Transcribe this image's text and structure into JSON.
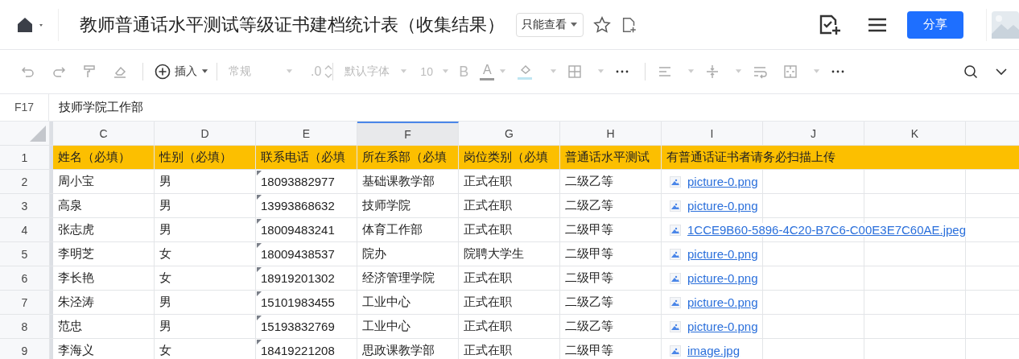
{
  "top_bar": {
    "title": "教师普通话水平测试等级证书建档统计表（收集结果）",
    "view_mode": "只能查看",
    "share_button": "分享"
  },
  "toolbar": {
    "insert": "插入",
    "number_format": "常规",
    "decimal": ".0",
    "font": "默认字体",
    "font_size": "10",
    "bold": "B",
    "font_color": "A"
  },
  "formula_bar": {
    "cell_ref": "F17",
    "value": "技师学院工作部"
  },
  "sheet": {
    "columns": [
      {
        "label": "C",
        "selected": false
      },
      {
        "label": "D",
        "selected": false
      },
      {
        "label": "E",
        "selected": false
      },
      {
        "label": "F",
        "selected": true
      },
      {
        "label": "G",
        "selected": false
      },
      {
        "label": "H",
        "selected": false
      },
      {
        "label": "I",
        "selected": false
      },
      {
        "label": "J",
        "selected": false
      },
      {
        "label": "K",
        "selected": false
      }
    ],
    "header_row": {
      "number": "1",
      "cells": [
        "姓名（必填）",
        "性别（必填）",
        "联系电话（必填",
        "所在系部（必填",
        "岗位类别（必填",
        "普通话水平测试"
      ],
      "wide_cell": "有普通话证书者请务必扫描上传"
    },
    "rows": [
      {
        "number": "2",
        "cells": [
          "周小宝",
          "男",
          "18093882977",
          "基础课教学部",
          "正式在职",
          "二级乙等"
        ],
        "attachment": "picture-0.png"
      },
      {
        "number": "3",
        "cells": [
          "高泉",
          "男",
          "13993868632",
          "技师学院",
          "正式在职",
          "二级乙等"
        ],
        "attachment": "picture-0.png"
      },
      {
        "number": "4",
        "cells": [
          "张志虎",
          "男",
          "18009483241",
          "体育工作部",
          "正式在职",
          "二级甲等"
        ],
        "attachment": "1CCE9B60-5896-4C20-B7C6-C00E3E7C60AE.jpeg"
      },
      {
        "number": "5",
        "cells": [
          "李明芝",
          "女",
          "18009438537",
          "院办",
          "院聘大学生",
          "二级甲等"
        ],
        "attachment": "picture-0.png"
      },
      {
        "number": "6",
        "cells": [
          "李长艳",
          "女",
          "18919201302",
          "经济管理学院",
          "正式在职",
          "二级甲等"
        ],
        "attachment": "picture-0.png"
      },
      {
        "number": "7",
        "cells": [
          "朱泾涛",
          "男",
          "15101983455",
          "工业中心",
          "正式在职",
          "二级乙等"
        ],
        "attachment": "picture-0.png"
      },
      {
        "number": "8",
        "cells": [
          "范忠",
          "男",
          "15193832769",
          "工业中心",
          "正式在职",
          "二级乙等"
        ],
        "attachment": "picture-0.png"
      },
      {
        "number": "9",
        "cells": [
          "李海义",
          "女",
          "18419221208",
          "思政课教学部",
          "正式在职",
          "二级甲等"
        ],
        "attachment": "image.jpg"
      }
    ]
  }
}
